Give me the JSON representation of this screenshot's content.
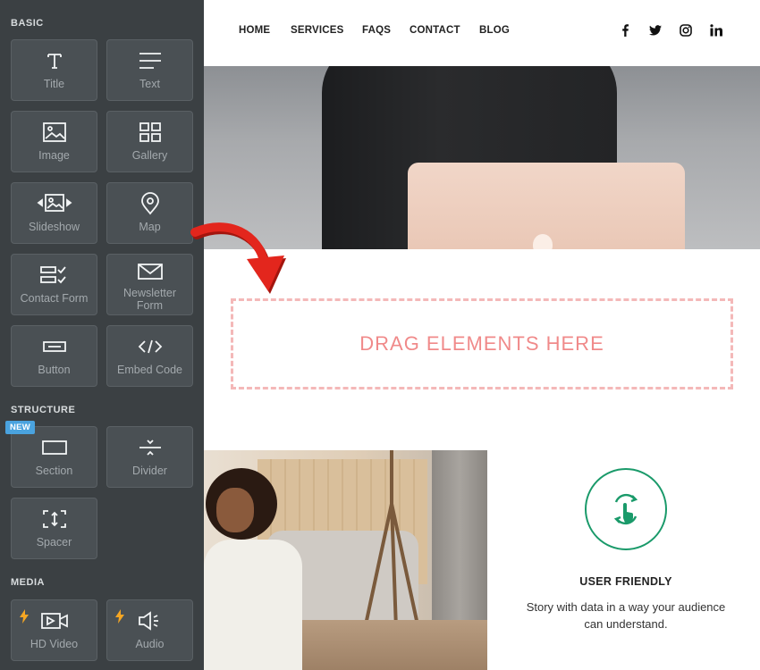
{
  "sidebar": {
    "sections": {
      "basic": "BASIC",
      "structure": "STRUCTURE",
      "media": "MEDIA"
    },
    "basic_items": [
      {
        "label": "Title",
        "icon": "title-icon"
      },
      {
        "label": "Text",
        "icon": "text-lines-icon"
      },
      {
        "label": "Image",
        "icon": "image-icon"
      },
      {
        "label": "Gallery",
        "icon": "gallery-grid-icon"
      },
      {
        "label": "Slideshow",
        "icon": "slideshow-icon"
      },
      {
        "label": "Map",
        "icon": "map-pin-icon"
      },
      {
        "label": "Contact Form",
        "icon": "contact-form-icon"
      },
      {
        "label": "Newsletter Form",
        "icon": "envelope-icon"
      },
      {
        "label": "Button",
        "icon": "button-icon"
      },
      {
        "label": "Embed Code",
        "icon": "code-icon"
      }
    ],
    "structure_items": [
      {
        "label": "Section",
        "icon": "section-icon",
        "badge": "NEW"
      },
      {
        "label": "Divider",
        "icon": "divider-icon"
      },
      {
        "label": "Spacer",
        "icon": "spacer-icon"
      }
    ],
    "media_items": [
      {
        "label": "HD Video",
        "icon": "video-icon",
        "premium": true
      },
      {
        "label": "Audio",
        "icon": "audio-icon",
        "premium": true
      }
    ]
  },
  "nav": {
    "items": [
      "HOME",
      "SERVICES",
      "FAQS",
      "CONTACT",
      "BLOG"
    ],
    "social": [
      "facebook-icon",
      "twitter-icon",
      "instagram-icon",
      "linkedin-icon"
    ]
  },
  "dropzone": {
    "text": "DRAG ELEMENTS HERE"
  },
  "feature": {
    "icon": "touch-refresh-icon",
    "title": "USER FRIENDLY",
    "description": "Story with data in a way your audience can understand."
  },
  "colors": {
    "sidebar_bg": "#3b4043",
    "tile_bg": "#4a5054",
    "dropzone_border": "#f4b8b8",
    "dropzone_text": "#f08a8a",
    "accent_green": "#1a9a6a",
    "arrow_red": "#e3261d",
    "bolt_orange": "#f5a623",
    "badge_blue": "#4aa3df"
  }
}
